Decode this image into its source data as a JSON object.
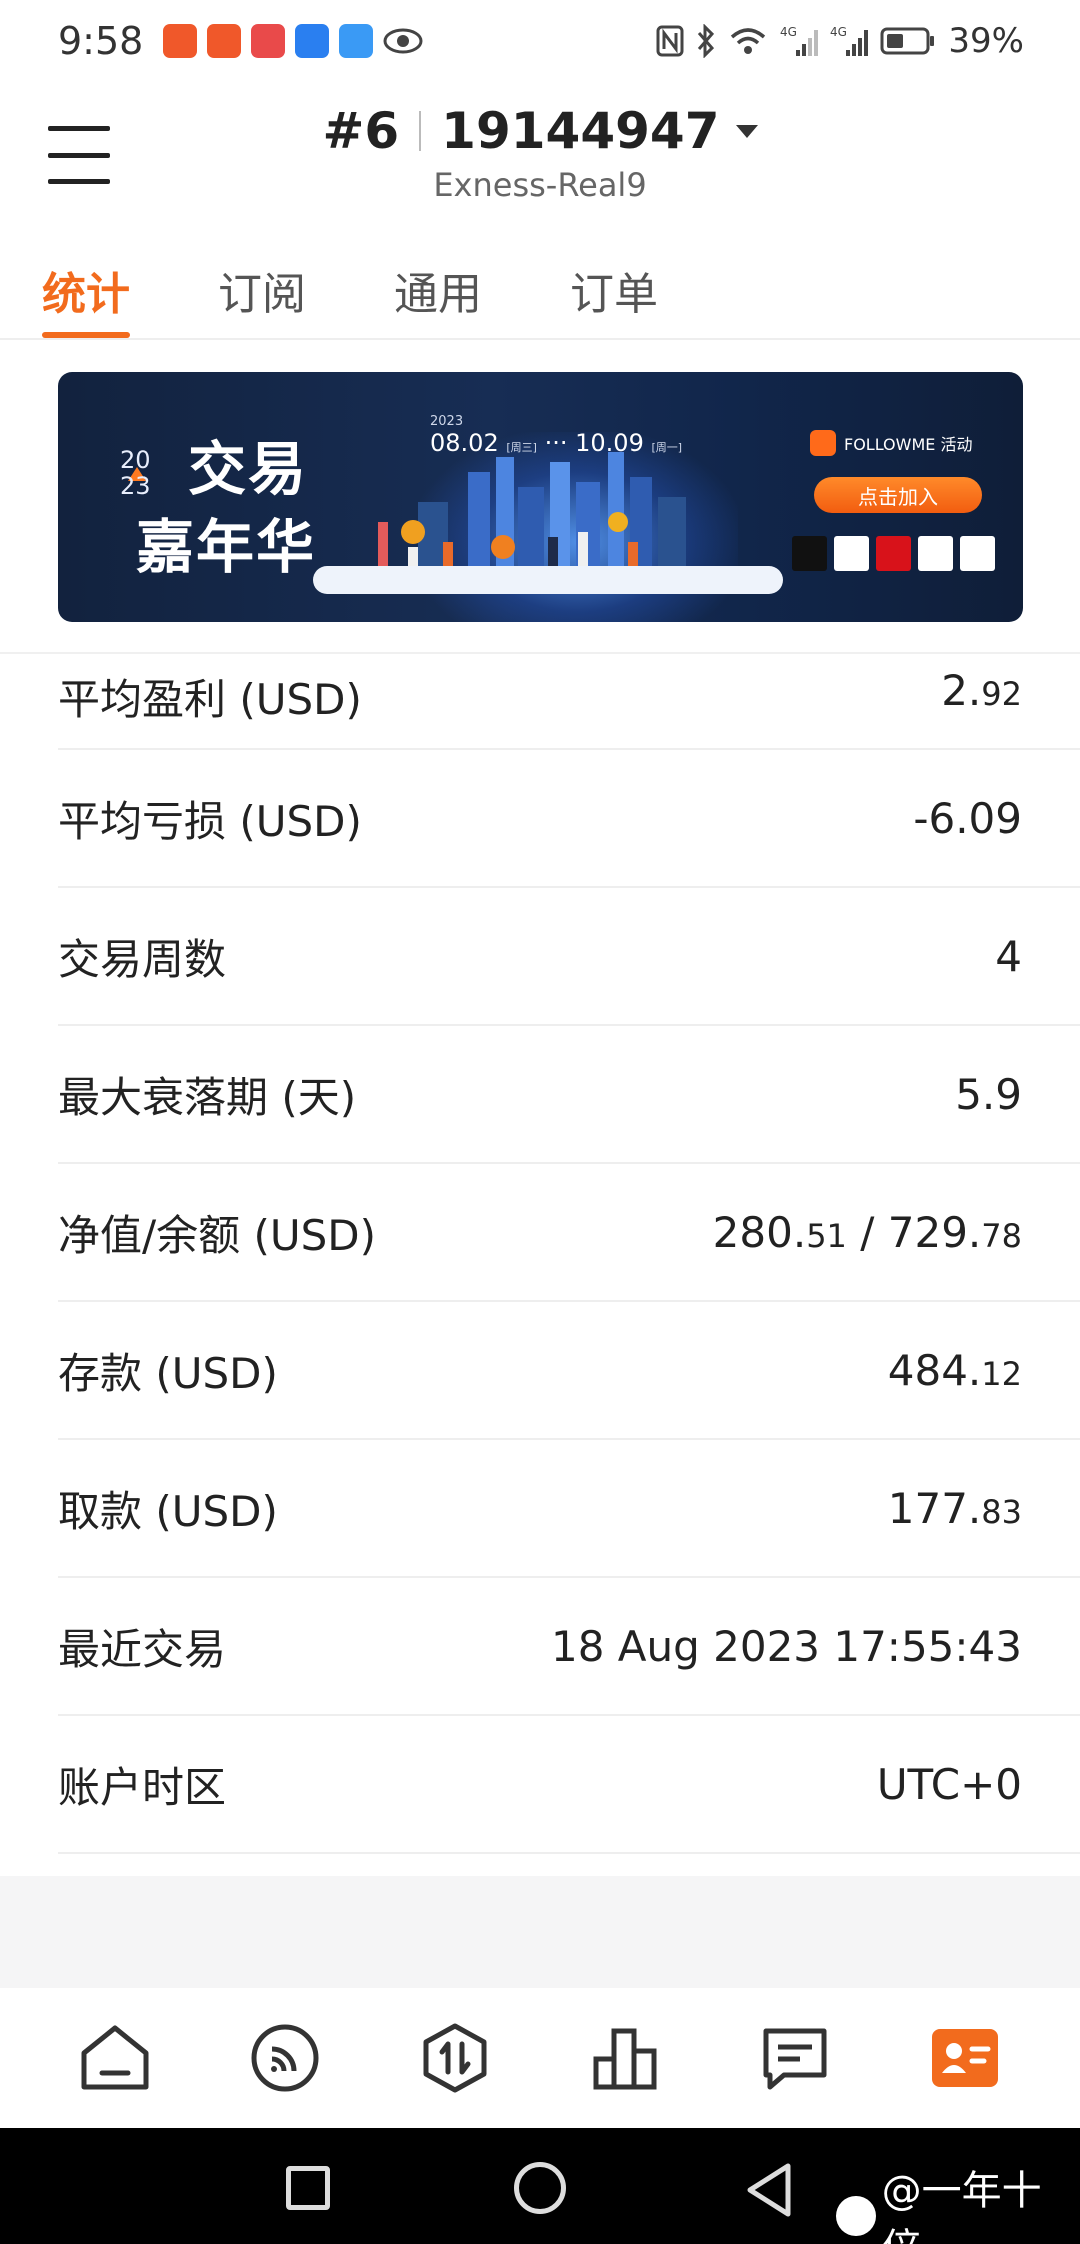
{
  "status_bar": {
    "time": "9:58",
    "battery": "39%",
    "network1": "4G",
    "network2": "4G"
  },
  "header": {
    "account_index": "#6",
    "account_number": "19144947",
    "server": "Exness-Real9"
  },
  "tabs": [
    {
      "label": "统计",
      "active": true
    },
    {
      "label": "订阅",
      "active": false
    },
    {
      "label": "通用",
      "active": false
    },
    {
      "label": "订单",
      "active": false
    }
  ],
  "banner": {
    "year": "20\n23",
    "title_line1": "交易",
    "title_line2": "嘉年华",
    "date_year": "2023",
    "date_start": "08.02",
    "date_start_day": "[周三]",
    "date_end": "10.09",
    "date_end_day": "[周一]",
    "brand": "FOLLOWME 活动",
    "join_label": "点击加入"
  },
  "stats": [
    {
      "label": "平均盈利 (USD)",
      "value_main": "2.",
      "value_small": "92"
    },
    {
      "label": "平均亏损 (USD)",
      "value_main": "-6.09",
      "value_small": ""
    },
    {
      "label": "交易周数",
      "value_main": "4",
      "value_small": ""
    },
    {
      "label": "最大衰落期 (天)",
      "value_main": "5.9",
      "value_small": ""
    },
    {
      "label": "净值/余额 (USD)",
      "value_main": "280.",
      "value_small": "51",
      "value_main2": " / 729.",
      "value_small2": "78"
    },
    {
      "label": "存款 (USD)",
      "value_main": "484.",
      "value_small": "12"
    },
    {
      "label": "取款 (USD)",
      "value_main": "177.",
      "value_small": "83"
    },
    {
      "label": "最近交易",
      "value_main": "18 Aug 2023 17:55:43",
      "value_small": ""
    },
    {
      "label": "账户时区",
      "value_main": "UTC+0",
      "value_small": ""
    }
  ],
  "bottom_nav": [
    "home-icon",
    "feed-icon",
    "trade-icon",
    "ranking-icon",
    "message-icon",
    "profile-icon"
  ],
  "watermark": "@一年十倍",
  "colors": {
    "accent": "#f26b1d",
    "banner_bg": "#172d54"
  }
}
